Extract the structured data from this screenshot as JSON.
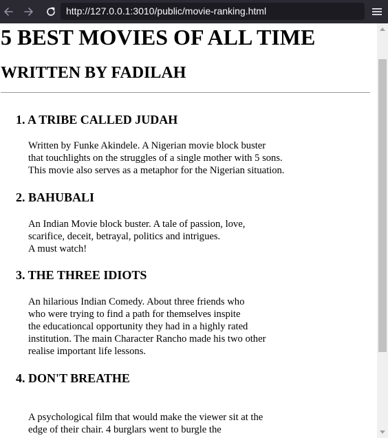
{
  "browser": {
    "url": "http://127.0.0.1:3010/public/movie-ranking.html",
    "back_icon": "arrow-left",
    "forward_icon": "arrow-right",
    "reload_icon": "reload",
    "menu_icon": "hamburger"
  },
  "page": {
    "title": "5 BEST MOVIES OF ALL TIME",
    "subtitle": "WRITTEN BY FADILAH",
    "movies": [
      {
        "title": "1. A TRIBE CALLED JUDAH",
        "lines": [
          "Written by Funke Akindele. A Nigerian movie block buster",
          "that touchlights on the struggles of a single mother with 5 sons.",
          "This movie also serves as a metaphor for the Nigerian situation."
        ]
      },
      {
        "title": "2. BAHUBALI",
        "lines": [
          "An Indian Movie block buster. A tale of passion, love,",
          "scarifice, deceit, betrayal, politics and intrigues.",
          "A must watch!"
        ]
      },
      {
        "title": "3. THE THREE IDIOTS",
        "lines": [
          "An hilarious Indian Comedy. About three friends who",
          "who were trying to find a path for themselves inspite",
          "the educationcal opportunity they had in a highly rated",
          "institution. The main Character Rancho made his two other",
          "realise important life lessons."
        ]
      },
      {
        "title": "4. DON'T BREATHE",
        "lines": [
          "A psychological film that would make the viewer sit at the",
          "edge of their chair. 4 burglars went to burgle the"
        ]
      }
    ]
  },
  "colors": {
    "toolbar_bg": "#2b2a33",
    "urlbar_bg": "#1c1b22",
    "text": "#000000"
  }
}
